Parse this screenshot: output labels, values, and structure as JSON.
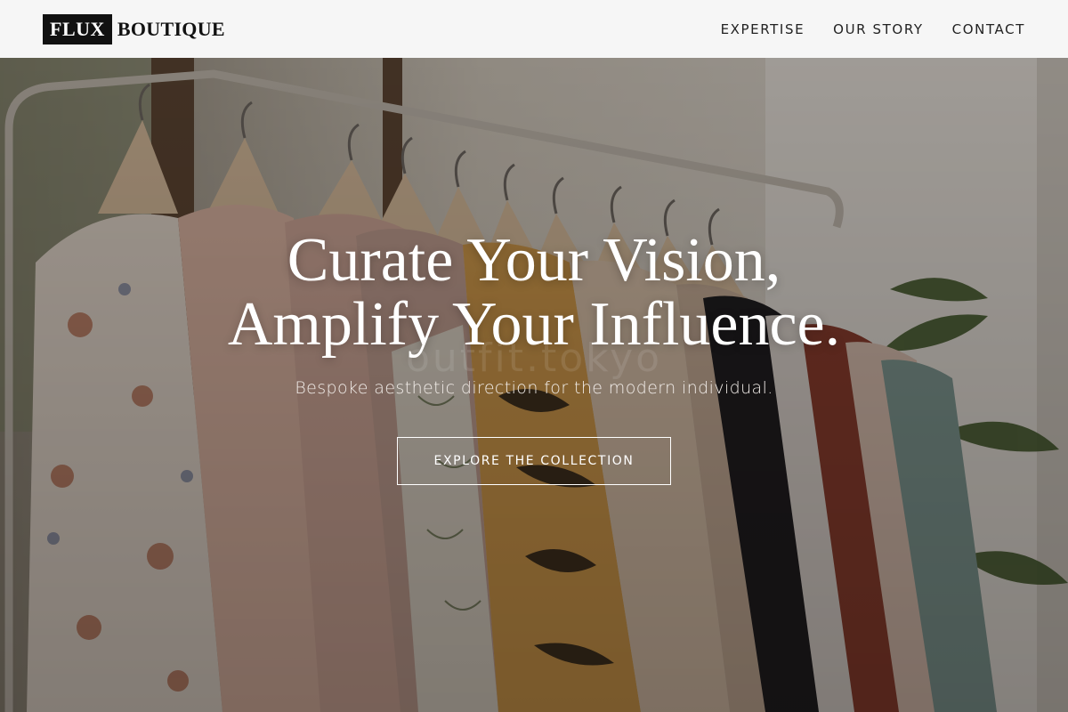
{
  "brand": {
    "logo_box": "FLUX",
    "logo_word": "BOUTIQUE"
  },
  "nav": {
    "items": [
      {
        "label": "EXPERTISE"
      },
      {
        "label": "OUR STORY"
      },
      {
        "label": "CONTACT"
      }
    ]
  },
  "hero": {
    "headline_line1": "Curate Your Vision,",
    "headline_line2": "Amplify Your Influence.",
    "subtitle": "Bespoke aesthetic direction for the modern individual.",
    "cta_label": "EXPLORE THE COLLECTION",
    "watermark": "outfit.tokyo",
    "background_image": "clothing-rack-photo"
  },
  "colors": {
    "header_bg": "#f6f6f6",
    "logo_box_bg": "#111111",
    "text_on_hero": "#ffffff"
  }
}
